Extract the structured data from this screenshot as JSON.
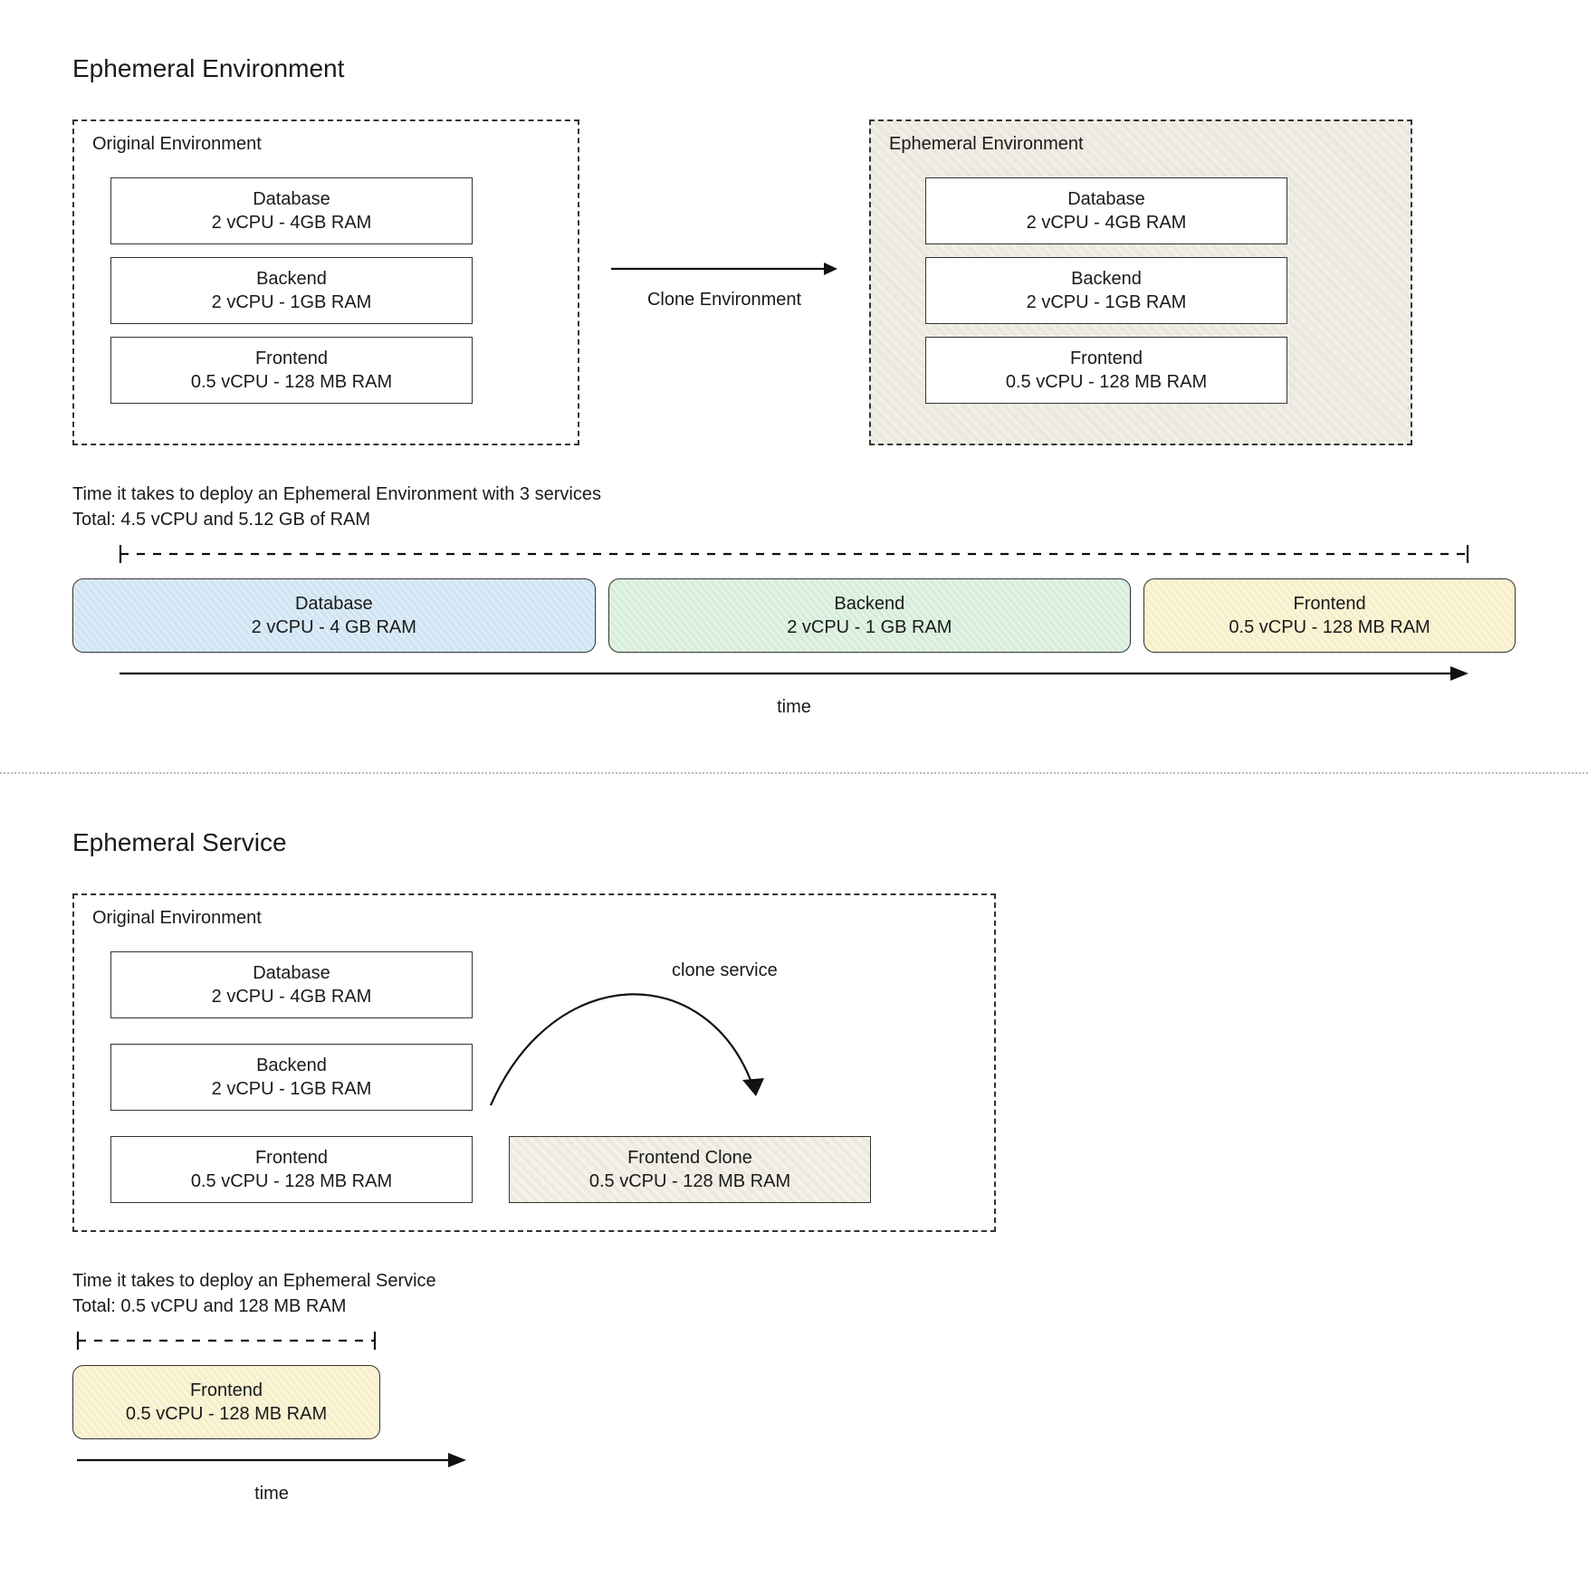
{
  "section1": {
    "title": "Ephemeral Environment",
    "original": {
      "label": "Original Environment",
      "services": {
        "db": {
          "name": "Database",
          "spec": "2 vCPU - 4GB RAM"
        },
        "be": {
          "name": "Backend",
          "spec": "2 vCPU - 1GB RAM"
        },
        "fe": {
          "name": "Frontend",
          "spec": "0.5 vCPU - 128 MB RAM"
        }
      }
    },
    "arrow_label": "Clone Environment",
    "cloned": {
      "label": "Ephemeral Environment",
      "services": {
        "db": {
          "name": "Database",
          "spec": "2 vCPU - 4GB RAM"
        },
        "be": {
          "name": "Backend",
          "spec": "2 vCPU - 1GB RAM"
        },
        "fe": {
          "name": "Frontend",
          "spec": "0.5 vCPU - 128 MB RAM"
        }
      }
    },
    "caption_l1": "Time it takes to deploy an Ephemeral Environment with 3 services",
    "caption_l2": "Total: 4.5 vCPU and 5.12 GB of RAM",
    "bars": {
      "db": {
        "name": "Database",
        "spec": "2 vCPU - 4 GB RAM"
      },
      "be": {
        "name": "Backend",
        "spec": "2 vCPU - 1 GB RAM"
      },
      "fe": {
        "name": "Frontend",
        "spec": "0.5 vCPU - 128 MB RAM"
      }
    },
    "axis": "time"
  },
  "section2": {
    "title": "Ephemeral Service",
    "original": {
      "label": "Original Environment",
      "services": {
        "db": {
          "name": "Database",
          "spec": "2 vCPU - 4GB RAM"
        },
        "be": {
          "name": "Backend",
          "spec": "2 vCPU - 1GB RAM"
        },
        "fe": {
          "name": "Frontend",
          "spec": "0.5 vCPU - 128 MB RAM"
        }
      },
      "clone": {
        "name": "Frontend Clone",
        "spec": "0.5 vCPU - 128 MB RAM"
      }
    },
    "arrow_label": "clone service",
    "caption_l1": "Time it takes to deploy an Ephemeral Service",
    "caption_l2": "Total: 0.5 vCPU and 128 MB RAM",
    "bar": {
      "name": "Frontend",
      "spec": "0.5 vCPU - 128 MB RAM"
    },
    "axis": "time"
  }
}
